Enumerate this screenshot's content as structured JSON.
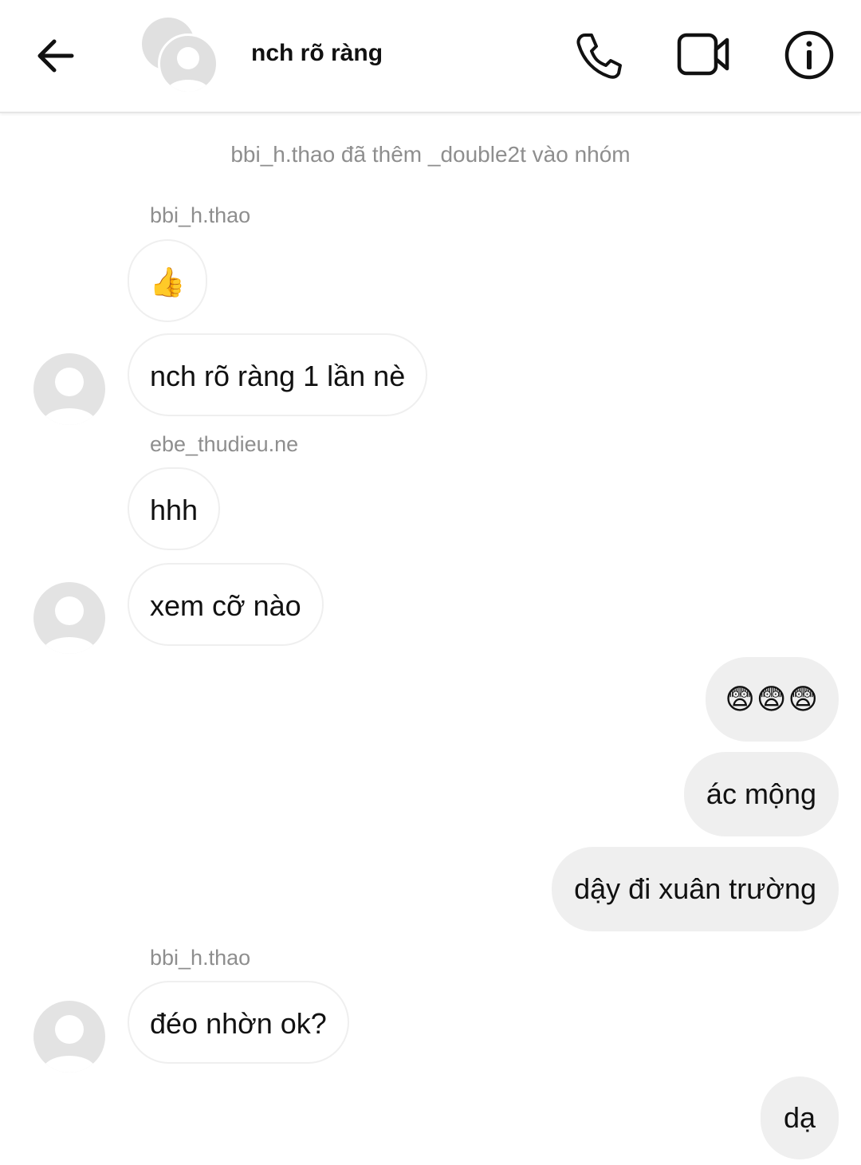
{
  "header": {
    "title": "nch rõ ràng",
    "icons": [
      "arrow-left-icon",
      "phone-icon",
      "video-camera-icon",
      "info-icon"
    ]
  },
  "chat": {
    "system_message": "bbi_h.thao đã thêm _double2t vào nhóm",
    "senders": {
      "s1": "bbi_h.thao",
      "s2": "ebe_thudieu.ne",
      "s3": "bbi_h.thao"
    },
    "messages": {
      "m1": "👍",
      "m2": "nch rõ ràng 1 lần nè",
      "m3": "hhh",
      "m4": "xem cỡ nào",
      "m5": "😨😨😨",
      "m6": "ác mộng",
      "m7": "dậy đi xuân trường",
      "m8": "đéo nhờn ok?",
      "m9": "dạ"
    }
  },
  "colors": {
    "outgoing_bubble": "#efefef",
    "incoming_border": "#efefef",
    "meta_text": "#8e8e8e",
    "avatar_placeholder": "#e3e3e3"
  }
}
